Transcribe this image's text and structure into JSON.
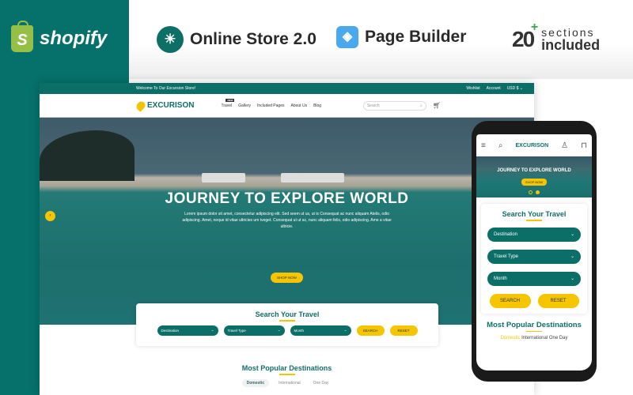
{
  "banner": {
    "brand": "shopify",
    "brand_icon_letter": "S",
    "features": [
      {
        "icon": "sunrise-icon",
        "label": "Online Store 2.0"
      },
      {
        "icon": "layers-icon",
        "label": "Page Builder"
      }
    ],
    "sections_count": "20",
    "sections_plus": "+",
    "sections_line1": "sections",
    "sections_line2": "included"
  },
  "desktop": {
    "topbar": {
      "welcome": "Welcome To Our Excursion Store!",
      "links": [
        "Wishlist",
        "Account",
        "USD $ ⌄"
      ]
    },
    "logo": "EXCURISON",
    "menu": [
      {
        "label": "Travel",
        "badge": "NEW"
      },
      {
        "label": "Gallery"
      },
      {
        "label": "Included Pages"
      },
      {
        "label": "About Us"
      },
      {
        "label": "Blog"
      }
    ],
    "search_placeholder": "Search",
    "hero": {
      "title": "JOURNEY TO EXPLORE WORLD",
      "text": "Lorem ipsum dolor sit amet, consectetur adipiscing elit. Sed seem ut us, ut is Consequat ac nunc aliquam Atelis, odio adipiscing. Amet, neque id vitae ultricies um tveget. Consequat ut ut ac, nunc aliquam felis, odio adipiscing. Ame a vitae ultricie.",
      "cta": "SHOP NOW",
      "prev": "‹"
    },
    "search_travel": {
      "title": "Search Your Travel",
      "selects": [
        "Destination",
        "Travel Type",
        "Month"
      ],
      "search_btn": "SEARCH",
      "reset_btn": "RESET"
    },
    "popular": {
      "title": "Most Popular Destinations",
      "tabs": [
        "Domestic",
        "International",
        "One Day"
      ],
      "active": "Domestic"
    }
  },
  "mobile": {
    "logo": "EXCURISON",
    "hero_title": "JOURNEY TO EXPLORE WORLD",
    "hero_cta": "SHOP NOW",
    "slides": 2,
    "active_slide": 2,
    "search_title": "Search Your Travel",
    "selects": [
      "Destination",
      "Travel Type",
      "Month"
    ],
    "search_btn": "SEARCH",
    "reset_btn": "RESET",
    "popular_title": "Most Popular Destinations",
    "tabs": [
      "Domestic",
      "International",
      "One Day"
    ]
  },
  "colors": {
    "teal": "#06716a",
    "yellow": "#f5c600",
    "shopify_green": "#95bf47"
  }
}
